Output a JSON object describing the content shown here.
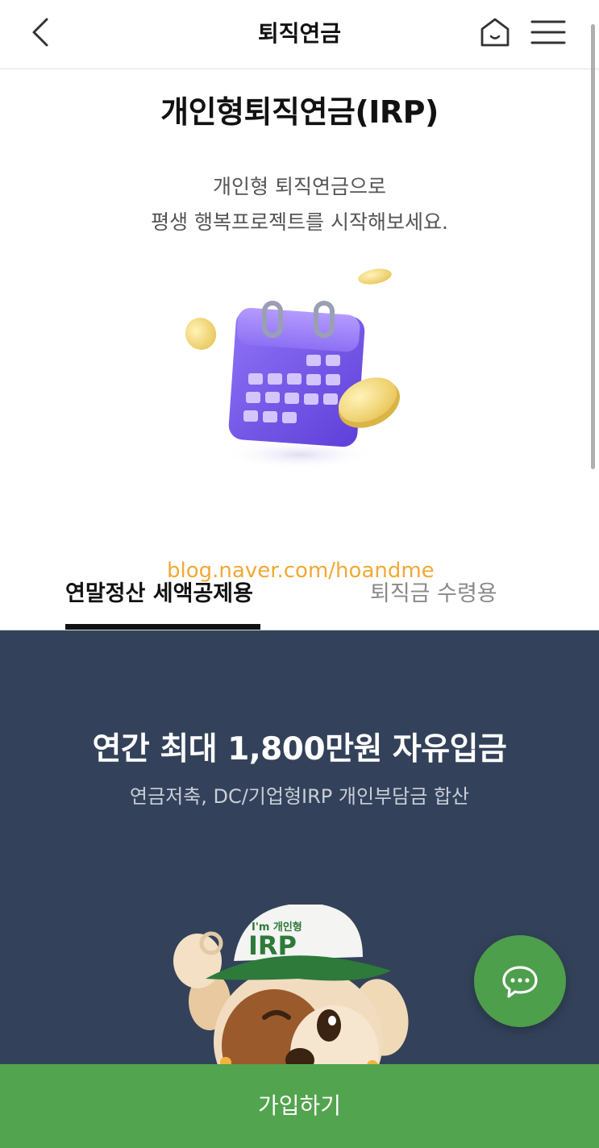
{
  "header": {
    "title": "퇴직연금",
    "back_icon": "chevron-left-icon",
    "home_icon": "home-icon",
    "menu_icon": "hamburger-menu-icon"
  },
  "hero": {
    "title": "개인형퇴직연금(IRP)",
    "desc_line1": "개인형 퇴직연금으로",
    "desc_line2": "평생 행복프로젝트를 시작해보세요."
  },
  "watermark": "blog.naver.com/hoandme",
  "tabs": [
    {
      "label": "연말정산 세액공제용",
      "selected": true
    },
    {
      "label": "퇴직금 수령용",
      "selected": false
    }
  ],
  "promo": {
    "title": "연간 최대 1,800만원 자유입금",
    "subtitle": "연금저축, DC/기업형IRP 개인부담금 합산",
    "mascot_cap_small": "I'm 개인형",
    "mascot_cap_big": "IRP"
  },
  "chat_fab": {
    "icon": "chat-bubble-icon"
  },
  "cta": {
    "label": "가입하기"
  },
  "colors": {
    "primary_green": "#53a44e",
    "dark_panel": "#33425a",
    "calendar_purple": "#7b5cf0",
    "coin_gold": "#f0d77a"
  }
}
